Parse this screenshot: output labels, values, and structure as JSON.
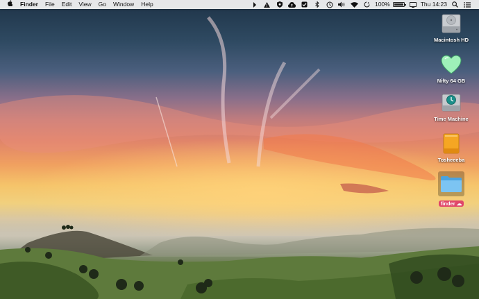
{
  "menubar": {
    "app_name": "Finder",
    "menus": [
      "File",
      "Edit",
      "View",
      "Go",
      "Window",
      "Help"
    ],
    "battery_percent": "100%",
    "battery_level": 1.0,
    "clock": "Thu 14:23"
  },
  "desktop": {
    "icons": [
      {
        "label": "Macintosh HD",
        "icon": "hard-drive-icon"
      },
      {
        "label": "Nifty 64 GB",
        "icon": "heart-drive-icon"
      },
      {
        "label": "Time Machine",
        "icon": "time-machine-icon"
      },
      {
        "label": "Tosheeeba",
        "icon": "external-drive-icon"
      },
      {
        "label": "finder",
        "icon": "folder-icon",
        "tag": "☁",
        "selected": true
      }
    ]
  }
}
